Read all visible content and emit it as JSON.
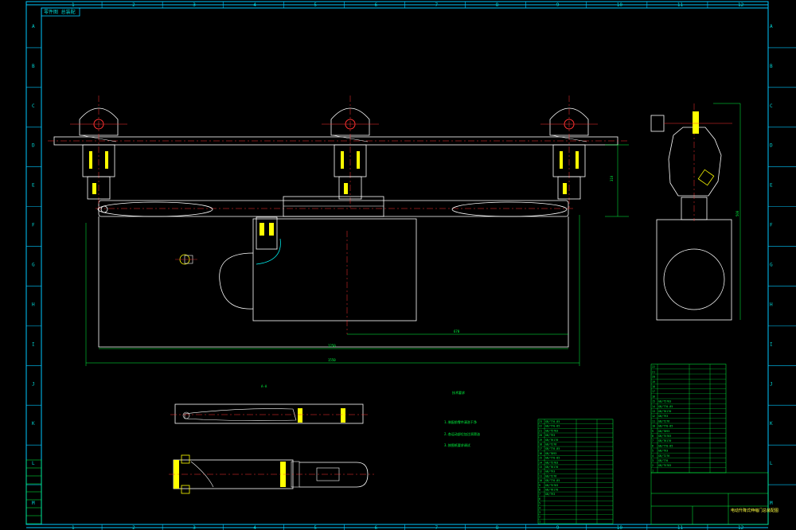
{
  "drawing": {
    "title_stamp": "零件图 总装配",
    "frame_color": "#00c8ff",
    "line_color": "#ffffff",
    "center_color": "#ff3030",
    "dim_color": "#00ff40",
    "accent_color": "#ffff00"
  },
  "zones": {
    "top": [
      "1",
      "2",
      "3",
      "4",
      "5",
      "6",
      "7",
      "8",
      "9",
      "10",
      "11",
      "12"
    ],
    "bottom": [
      "1",
      "2",
      "3",
      "4",
      "5",
      "6",
      "7",
      "8",
      "9",
      "10",
      "11",
      "12"
    ],
    "side": [
      "A",
      "B",
      "C",
      "D",
      "E",
      "F",
      "G",
      "H",
      "I",
      "J",
      "K",
      "L",
      "M"
    ]
  },
  "dimensions": {
    "inner_width": "1250",
    "outer_width": "1550",
    "half_width": "670",
    "height": "310",
    "side_height": "500"
  },
  "notes": {
    "section_label": "A-A",
    "tech_title": "技术要求",
    "req1": "1.装配前零件清洗干净",
    "req2": "2.各运动部位加注润滑油",
    "req3": "3.按图纸要求调试"
  },
  "title_block": {
    "name": "电动升降式伸缩门总装配图"
  },
  "bom_left": [
    [
      "23",
      "GB/T70-85",
      "",
      ""
    ],
    [
      "22",
      "GB/T70-85",
      "",
      ""
    ],
    [
      "21",
      "GB/T5783",
      "",
      ""
    ],
    [
      "20",
      "GB/T93",
      "",
      ""
    ],
    [
      "19",
      "GB/T6170",
      "",
      ""
    ],
    [
      "18",
      "GB/T276",
      "",
      ""
    ],
    [
      "17",
      "GB/T70-85",
      "",
      ""
    ],
    [
      "16",
      "GB/T893",
      "",
      ""
    ],
    [
      "15",
      "GB/T70-85",
      "",
      ""
    ],
    [
      "14",
      "GB/T5783",
      "",
      ""
    ],
    [
      "13",
      "GB/T6170",
      "",
      ""
    ],
    [
      "12",
      "GB/T93",
      "",
      ""
    ],
    [
      "11",
      "GB/T276",
      "",
      ""
    ],
    [
      "10",
      "GB/T70-85",
      "",
      ""
    ],
    [
      "9",
      "GB/T5783",
      "",
      ""
    ],
    [
      "8",
      "GB/T6170",
      "",
      ""
    ],
    [
      "7",
      "GB/T93",
      "",
      ""
    ],
    [
      "6",
      "",
      "",
      ""
    ],
    [
      "5",
      "",
      "",
      ""
    ],
    [
      "4",
      "",
      "",
      ""
    ],
    [
      "3",
      "",
      "",
      ""
    ],
    [
      "2",
      "",
      "",
      ""
    ],
    [
      "1",
      "",
      "",
      ""
    ]
  ],
  "bom_right": [
    [
      "22",
      "",
      "",
      ""
    ],
    [
      "21",
      "",
      "",
      ""
    ],
    [
      "20",
      "",
      "",
      ""
    ],
    [
      "19",
      "",
      "",
      ""
    ],
    [
      "18",
      "",
      "",
      ""
    ],
    [
      "17",
      "",
      "",
      ""
    ],
    [
      "16",
      "",
      "",
      ""
    ],
    [
      "15",
      "GB/T5783",
      "",
      ""
    ],
    [
      "14",
      "GB/T70-85",
      "",
      ""
    ],
    [
      "13",
      "GB/T6170",
      "",
      ""
    ],
    [
      "12",
      "GB/T93",
      "",
      ""
    ],
    [
      "11",
      "GB/T276",
      "",
      ""
    ],
    [
      "10",
      "GB/T70-85",
      "",
      ""
    ],
    [
      "9",
      "GB/T893",
      "",
      ""
    ],
    [
      "8",
      "GB/T5783",
      "",
      ""
    ],
    [
      "7",
      "GB/T6170",
      "",
      ""
    ],
    [
      "6",
      "GB/T70-85",
      "",
      ""
    ],
    [
      "5",
      "GB/T93",
      "",
      ""
    ],
    [
      "4",
      "GB/T276",
      "",
      ""
    ],
    [
      "3",
      "GB/T70",
      "",
      ""
    ],
    [
      "2",
      "GB/T5783",
      "",
      ""
    ],
    [
      "1",
      "",
      "",
      ""
    ]
  ]
}
